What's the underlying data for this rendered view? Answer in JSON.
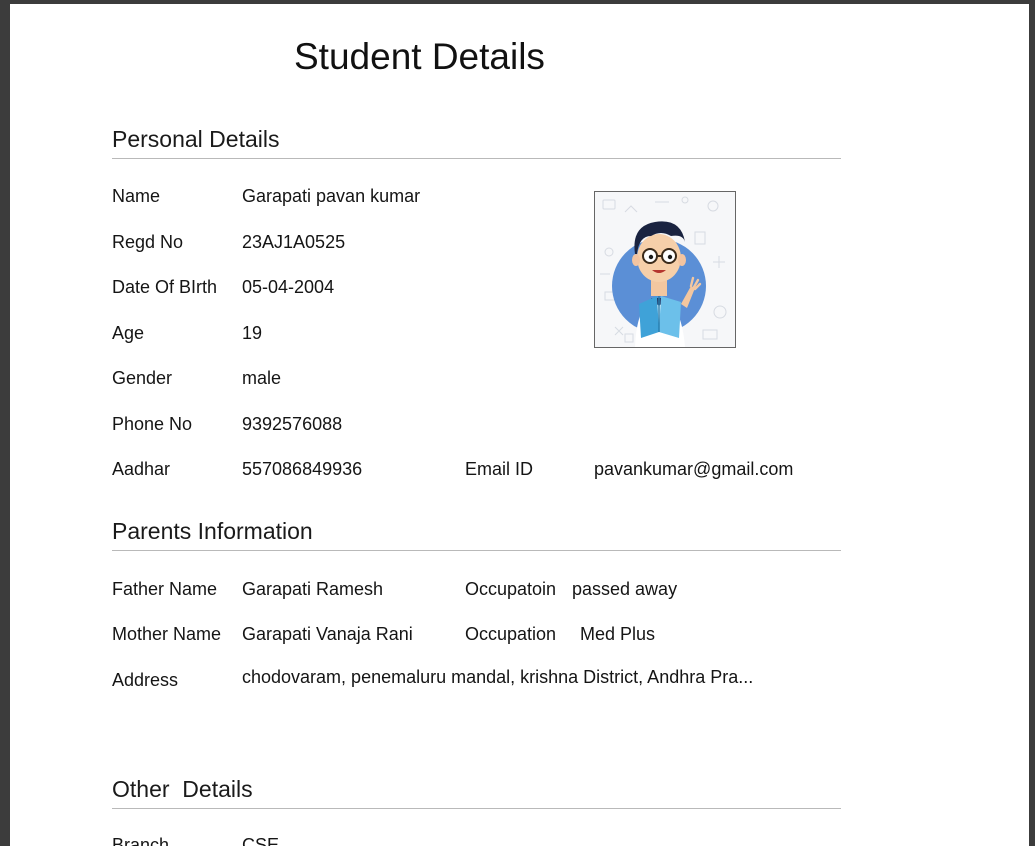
{
  "page_title": "Student Details",
  "personal": {
    "heading": "Personal Details",
    "name_label": "Name",
    "name_value": "Garapati pavan kumar",
    "regd_label": "Regd No",
    "regd_value": "23AJ1A0525",
    "dob_label": "Date Of BIrth",
    "dob_value": "05-04-2004",
    "age_label": "Age",
    "age_value": "19",
    "gender_label": "Gender",
    "gender_value": "male",
    "phone_label": "Phone No",
    "phone_value": "9392576088",
    "aadhar_label": "Aadhar",
    "aadhar_value": "557086849936",
    "email_label": "Email ID",
    "email_value": "pavankumar@gmail.com",
    "photo_icon": "student-reading-avatar"
  },
  "parents": {
    "heading": "Parents Information",
    "father_label": "Father Name",
    "father_value": "Garapati Ramesh",
    "father_occ_label": "Occupatoin",
    "father_occ_value": "passed away",
    "mother_label": "Mother Name",
    "mother_value": "Garapati Vanaja Rani",
    "mother_occ_label": "Occupation",
    "mother_occ_value": "Med Plus",
    "address_label": "Address",
    "address_value": "chodovaram, penemaluru mandal, krishna District, Andhra Pra..."
  },
  "other": {
    "heading": "Other  Details",
    "branch_label": "Branch",
    "branch_value": "CSE"
  },
  "colors": {
    "viewer_background": "#3c3c3c",
    "page_background": "#ffffff",
    "rule": "#b9b9b9",
    "avatar_circle": "#5b8fd6"
  }
}
